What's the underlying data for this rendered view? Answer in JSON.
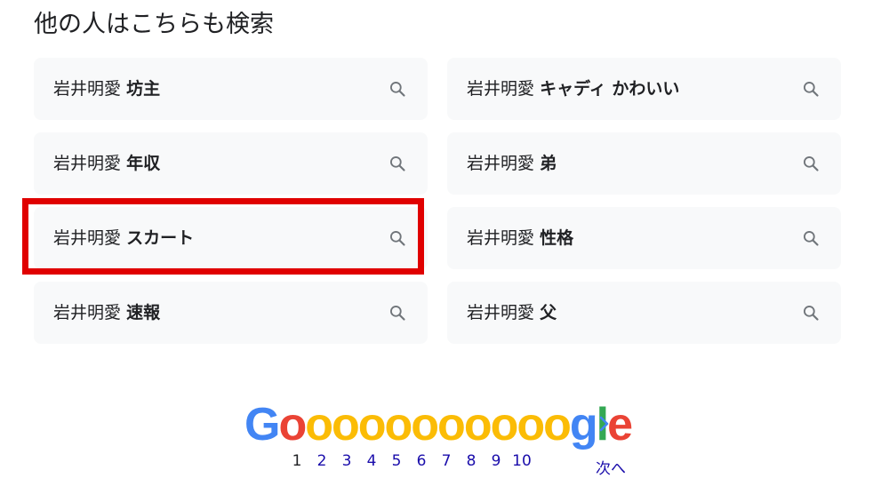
{
  "section": {
    "title": "他の人はこちらも検索"
  },
  "related": [
    {
      "prefix": "岩井明愛",
      "term": "坊主"
    },
    {
      "prefix": "岩井明愛",
      "term": "キャディ かわいい"
    },
    {
      "prefix": "岩井明愛",
      "term": "年収"
    },
    {
      "prefix": "岩井明愛",
      "term": "弟"
    },
    {
      "prefix": "岩井明愛",
      "term": "スカート"
    },
    {
      "prefix": "岩井明愛",
      "term": "性格"
    },
    {
      "prefix": "岩井明愛",
      "term": "速報"
    },
    {
      "prefix": "岩井明愛",
      "term": "父"
    }
  ],
  "icons": {
    "chip": "search-icon",
    "next": "chevron-right-icon"
  },
  "pagination": {
    "logo": {
      "G": "G",
      "o": "o",
      "gl": "g",
      "l": "l",
      "e": "e"
    },
    "pages": [
      "1",
      "2",
      "3",
      "4",
      "5",
      "6",
      "7",
      "8",
      "9",
      "10"
    ],
    "current": "1",
    "next_label": "次へ"
  },
  "colors": {
    "highlight": "#e00000",
    "chip_bg": "#f8f9fa",
    "link": "#1a0dab",
    "google_blue": "#4285f4",
    "google_red": "#ea4335",
    "google_yellow": "#fbbc05",
    "google_green": "#34a853"
  }
}
